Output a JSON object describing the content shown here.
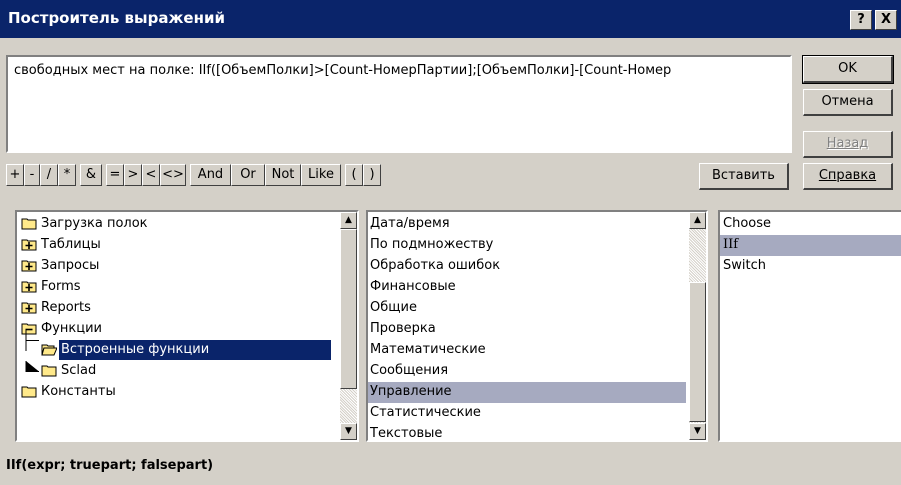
{
  "window": {
    "title": "Построитель выражений",
    "help_btn": "?",
    "close_btn": "X"
  },
  "expression": {
    "text": "свободных мест на полке: IIf([ОбъемПолки]>[Count-НомерПартии];[ОбъемПолки]-[Count-Номер"
  },
  "buttons": {
    "ok": "OK",
    "cancel": "Отмена",
    "back": "Назад",
    "insert": "Вставить",
    "help": "Справка"
  },
  "operators": [
    "+",
    "-",
    "/",
    "*",
    "&",
    "=",
    ">",
    "<",
    "<>",
    "And",
    "Or",
    "Not",
    "Like",
    "(",
    ")"
  ],
  "tree": {
    "items": [
      {
        "label": "Загрузка полок",
        "icon": "folder-icon"
      },
      {
        "label": "Таблицы",
        "icon": "expand-plus-icon"
      },
      {
        "label": "Запросы",
        "icon": "expand-plus-icon"
      },
      {
        "label": "Forms",
        "icon": "expand-plus-icon"
      },
      {
        "label": "Reports",
        "icon": "expand-plus-icon"
      },
      {
        "label": "Функции",
        "icon": "collapse-minus-icon"
      },
      {
        "label": "Встроенные функции",
        "icon": "open-folder-icon",
        "selected": true
      },
      {
        "label": "Sclad",
        "icon": "folder-icon"
      },
      {
        "label": "Константы",
        "icon": "folder-icon"
      }
    ]
  },
  "categories": {
    "items": [
      "Дата/время",
      "По подмножеству",
      "Обработка ошибок",
      "Финансовые",
      "Общие",
      "Проверка",
      "Математические",
      "Сообщения",
      "Управление",
      "Статистические",
      "Текстовые"
    ],
    "selected": "Управление"
  },
  "functions": {
    "items": [
      "Choose",
      "IIf",
      "Switch"
    ],
    "selected": "IIf"
  },
  "status": {
    "syntax": "IIf(expr; truepart; falsepart)"
  },
  "colors": {
    "titlebar": "#0a246a",
    "face": "#d4d0c8",
    "selection_active": "#0a246a",
    "selection_inactive": "#a6aac0"
  }
}
